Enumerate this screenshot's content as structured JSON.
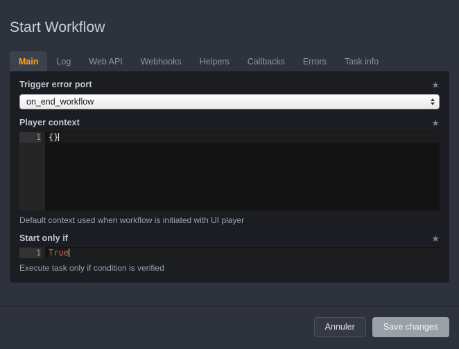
{
  "window": {
    "title": "Start Workflow"
  },
  "tabs": [
    {
      "label": "Main",
      "active": true
    },
    {
      "label": "Log",
      "active": false
    },
    {
      "label": "Web API",
      "active": false
    },
    {
      "label": "Webhooks",
      "active": false
    },
    {
      "label": "Helpers",
      "active": false
    },
    {
      "label": "Callbacks",
      "active": false
    },
    {
      "label": "Errors",
      "active": false
    },
    {
      "label": "Task info",
      "active": false
    }
  ],
  "fields": {
    "trigger_error_port": {
      "label": "Trigger error port",
      "star_icon": "star-icon",
      "star_glyph": "★",
      "value": "on_end_workflow",
      "options": [
        "on_end_workflow"
      ]
    },
    "player_context": {
      "label": "Player context",
      "star_icon": "star-icon",
      "star_glyph": "★",
      "line_numbers": [
        "1"
      ],
      "code": "{}",
      "help": "Default context used when workflow is initiated with UI player"
    },
    "start_only_if": {
      "label": "Start only if",
      "star_icon": "star-icon",
      "star_glyph": "★",
      "line_numbers": [
        "1"
      ],
      "code": "True",
      "help": "Execute task only if condition is verified"
    }
  },
  "footer": {
    "cancel_label": "Annuler",
    "save_label": "Save changes"
  },
  "colors": {
    "page_background": "#2d323c",
    "panel_background": "#1b1d22",
    "editor_background": "#131313",
    "gutter_background": "#252525",
    "accent_active_tab": "#f5a623",
    "keyword_token": "#c0694a",
    "primary_button": "#9aa0a8"
  }
}
